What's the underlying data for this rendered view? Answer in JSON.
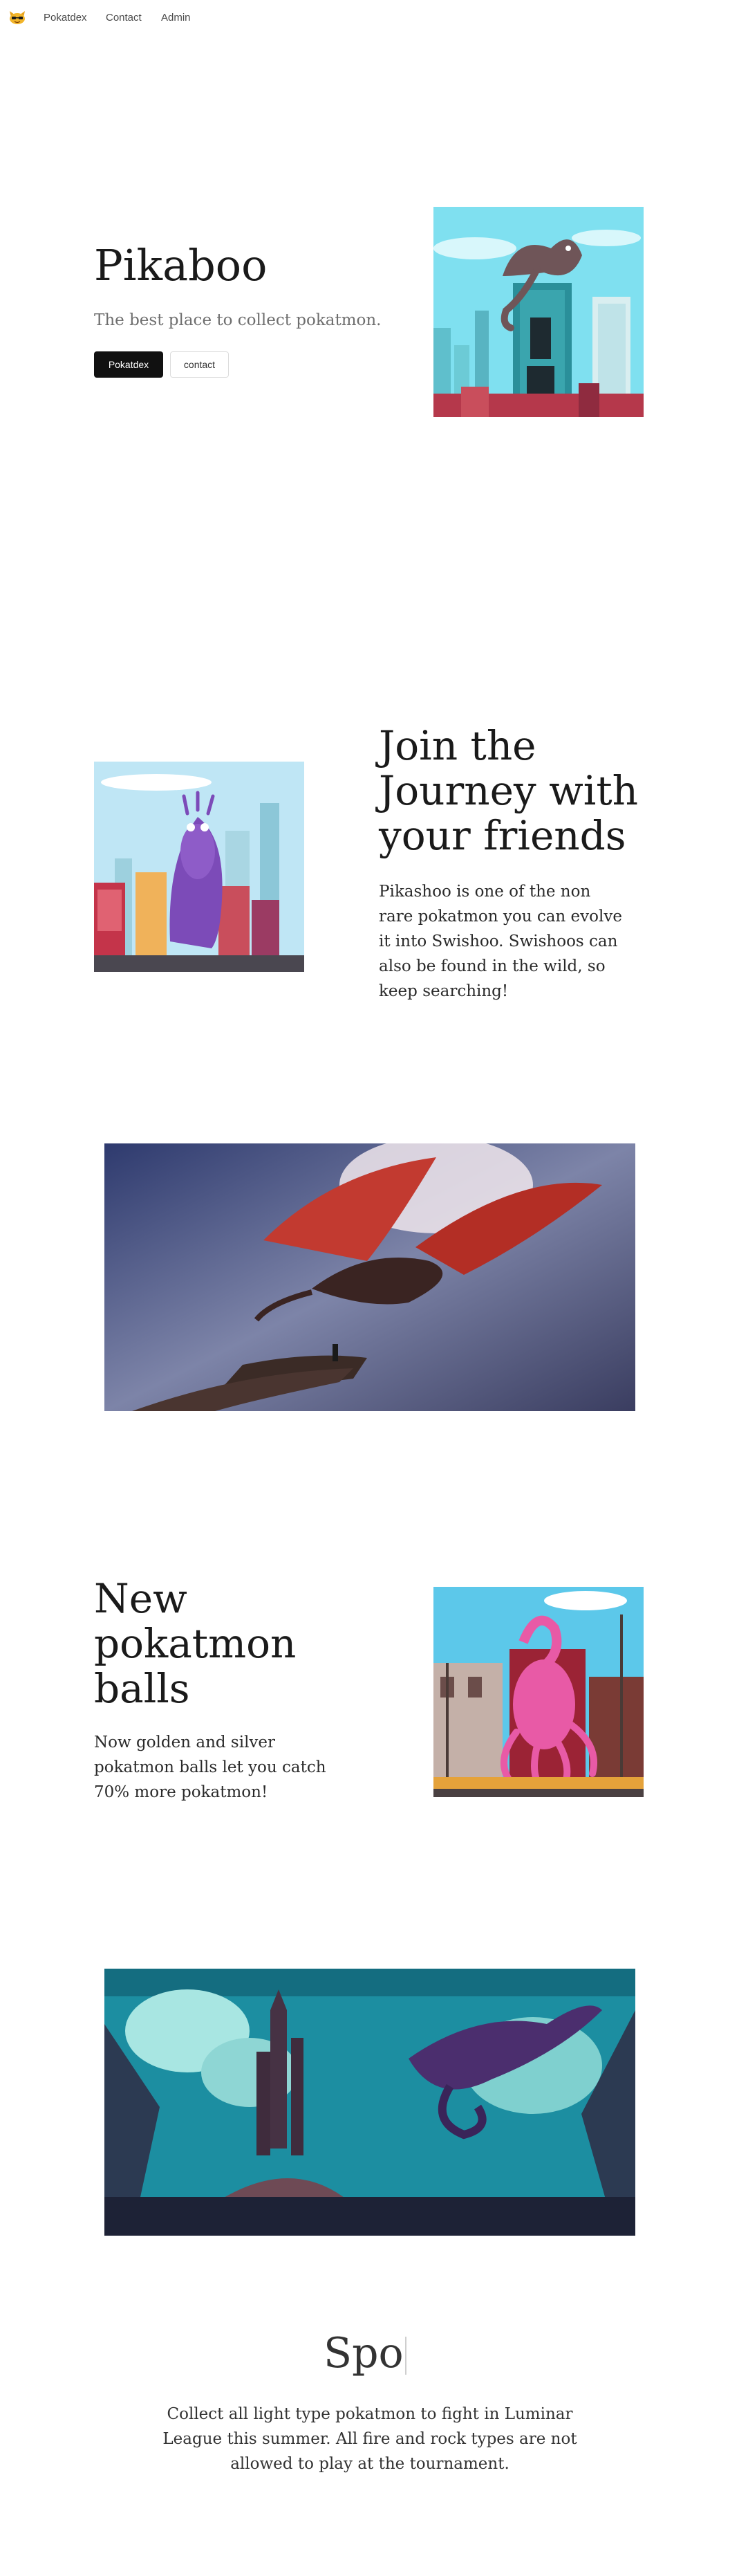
{
  "nav": {
    "logo_icon": "cat-face-icon",
    "links": [
      "Pokatdex",
      "Contact",
      "Admin"
    ]
  },
  "hero": {
    "title": "Pikaboo",
    "subtitle": "The best place to collect pokatmon.",
    "primary_button": "Pokatdex",
    "secondary_button": "contact"
  },
  "journey": {
    "title": "Join the Journey with your friends",
    "text": "Pikashoo is one of the non rare pokatmon you can evolve it into Swishoo. Swishoos can also be found in the wild, so keep searching!"
  },
  "balls": {
    "title": "New pokatmon balls",
    "text": "Now golden and silver pokatmon balls let you catch 70% more pokatmon!"
  },
  "spotlight": {
    "title": "Spo",
    "text": "Collect all light type pokatmon to fight in Luminar League this summer. All fire and rock types are not allowed to play at the tournament."
  },
  "colors": {
    "primary_button_bg": "#111111",
    "page_bg": "#ffffff"
  }
}
